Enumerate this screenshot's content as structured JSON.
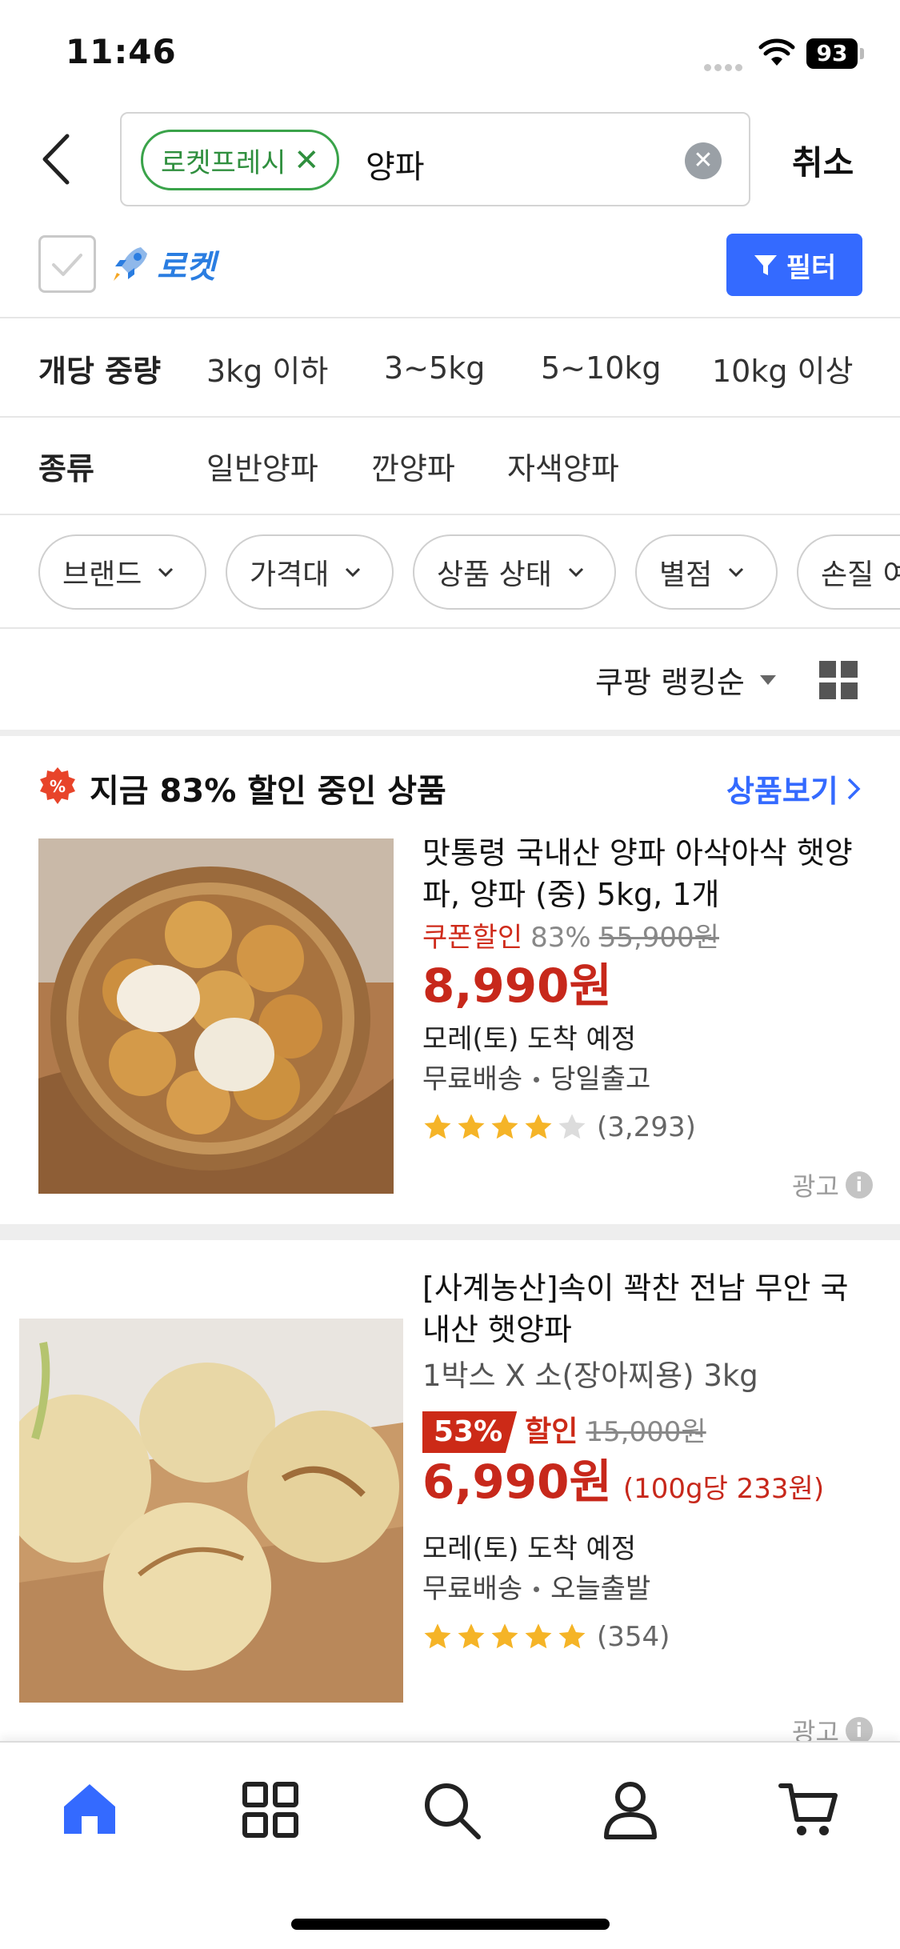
{
  "status_bar": {
    "time": "11:46",
    "battery": "93"
  },
  "search": {
    "chip_label": "로켓프레시",
    "query": "양파",
    "cancel_label": "취소"
  },
  "rocket_filter": {
    "label": "로켓",
    "filter_label": "필터"
  },
  "weight_filter": {
    "title": "개당 중량",
    "options": [
      "3kg 이하",
      "3~5kg",
      "5~10kg",
      "10kg 이상"
    ]
  },
  "type_filter": {
    "title": "종류",
    "options": [
      "일반양파",
      "깐양파",
      "자색양파"
    ]
  },
  "filter_chips": [
    "브랜드",
    "가격대",
    "상품 상태",
    "별점",
    "손질 여부"
  ],
  "sort": {
    "label": "쿠팡 랭킹순"
  },
  "promo": {
    "title": "지금 83% 할인 중인 상품",
    "more_label": "상품보기",
    "badge_symbol": "%"
  },
  "products": [
    {
      "title": "맛통령 국내산 양파 아삭아삭 햇양파, 양파 (중) 5kg, 1개",
      "coupon_label": "쿠폰할인",
      "discount_pct": "83%",
      "original_price": "55,900원",
      "price": "8,990원",
      "eta": "모레(토) 도착 예정",
      "shipping": "무료배송",
      "dispatch": "당일출고",
      "rating": 4,
      "review_count": "(3,293)",
      "ad_label": "광고"
    },
    {
      "title": "[사계농산]속이 꽉찬 전남 무안 국내산 햇양파",
      "option": "1박스 X 소(장아찌용) 3kg",
      "discount_pct": "53%",
      "sale_word": "할인",
      "original_price": "15,000원",
      "price": "6,990원",
      "unit_price": "(100g당 233원)",
      "eta": "모레(토) 도착 예정",
      "shipping": "무료배송",
      "dispatch": "오늘출발",
      "rating": 5,
      "review_count": "(354)",
      "ad_label": "광고"
    }
  ],
  "colors": {
    "accent_blue": "#346aff",
    "price_red": "#c7281b",
    "rocket_fresh_green": "#3aa34a",
    "star_gold": "#f5b427"
  },
  "icons": [
    "back-chevron-icon",
    "clear-icon",
    "rocket-icon",
    "funnel-icon",
    "home-icon",
    "category-grid-icon",
    "search-icon",
    "account-icon",
    "cart-icon"
  ]
}
